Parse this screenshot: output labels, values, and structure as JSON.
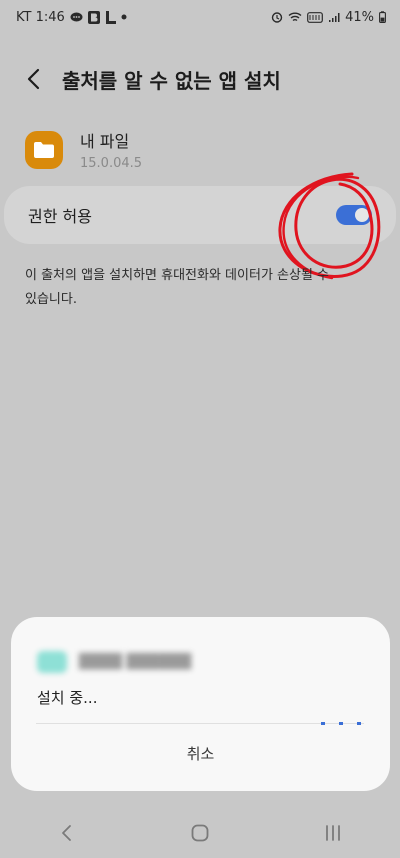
{
  "status_bar": {
    "carrier_time": "KT 1:46",
    "notification_icons": [
      "chat-bubble-icon",
      "b-app-icon",
      "l-app-icon",
      "dot-icon"
    ],
    "system_icons": [
      "alarm-icon",
      "wifi-icon",
      "volte-icon",
      "signal-icon"
    ],
    "battery": "41%"
  },
  "header": {
    "title": "출처를 알 수 없는 앱 설치"
  },
  "app": {
    "name": "내 파일",
    "version": "15.0.04.5",
    "icon": "folder-icon",
    "icon_color": "#d98a0b"
  },
  "permission": {
    "label": "권한 허용",
    "enabled": true,
    "toggle_color": "#3b6fd6"
  },
  "warning": {
    "line1": "이 출처의 앱을 설치하면 휴대전화와 데이터가 손상될 수",
    "line2": "있습니다."
  },
  "install_sheet": {
    "status": "설치 중...",
    "cancel_label": "취소"
  },
  "annotation": {
    "color": "#e0141f"
  },
  "nav": {
    "items": [
      "back-icon",
      "home-icon",
      "recents-icon"
    ]
  }
}
